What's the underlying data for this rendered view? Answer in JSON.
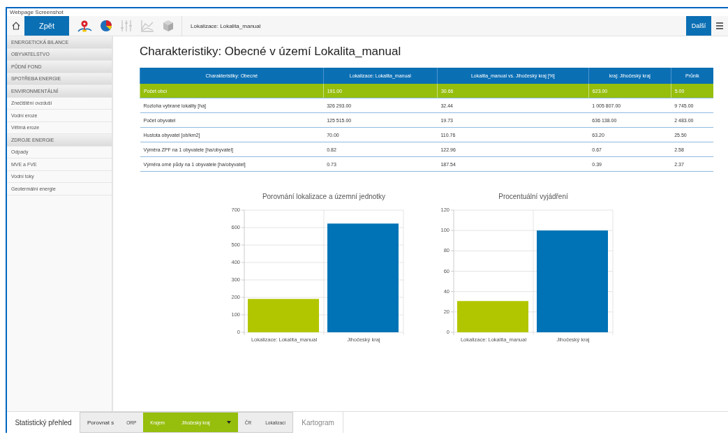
{
  "caption": "Webpage Screenshot",
  "toolbar": {
    "back_button": "Zpět",
    "tools": [
      {
        "kind": "pin",
        "disabled": false
      },
      {
        "kind": "pie",
        "disabled": false
      },
      {
        "kind": "sliders",
        "disabled": true
      },
      {
        "kind": "linechart",
        "disabled": true
      },
      {
        "kind": "cube",
        "disabled": true
      }
    ],
    "location": "Lokalizace: Lokalita_manual",
    "next_button": "Další"
  },
  "sidebar": {
    "items": [
      {
        "label": "ENERGETICKÁ BILANCE"
      },
      {
        "label": "OBYVATELSTVO"
      },
      {
        "label": "PŮDNÍ FOND"
      },
      {
        "label": "SPOTŘEBA ENERGIE"
      },
      {
        "label": "ENVIRONMENTÁLNÍ",
        "children": [
          {
            "label": "Znečištění ovzduší"
          },
          {
            "label": "Vodní eroze"
          },
          {
            "label": "Větrná eroze"
          }
        ]
      },
      {
        "label": "ZDROJE ENERGIE",
        "children": [
          {
            "label": "Odpady"
          },
          {
            "label": "MVE a FVE"
          },
          {
            "label": "Vodní toky"
          },
          {
            "label": "Geotermální energie"
          }
        ]
      }
    ]
  },
  "heading": "Charakteristiky: Obecné v území Lokalita_manual",
  "table": {
    "columns": [
      "Charakteristiky: Obecné",
      "Lokalizace: Lokalita_manual",
      "Lokalita_manual vs. Jihočeský kraj [%]",
      "kraj: Jihočeský kraj",
      "Průnik"
    ],
    "rows": [
      {
        "selected": true,
        "cells": [
          "Počet obcí",
          "191.00",
          "30.66",
          "623.00",
          "5.00"
        ]
      },
      {
        "selected": false,
        "cells": [
          "Rozloha vybrané lokality [ha]",
          "326 293.00",
          "32.44",
          "1 005 807.00",
          "9 745.00"
        ]
      },
      {
        "selected": false,
        "cells": [
          "Počet obyvatel",
          "125 515.00",
          "19.73",
          "636 138.00",
          "2 483.00"
        ]
      },
      {
        "selected": false,
        "cells": [
          "Hustota obyvatel [ob/km2]",
          "70.00",
          "110.76",
          "63.20",
          "25.50"
        ]
      },
      {
        "selected": false,
        "cells": [
          "Výměra ZPF na 1 obyvatele [ha/obyvatel]",
          "0.82",
          "122.96",
          "0.67",
          "2.58"
        ]
      },
      {
        "selected": false,
        "cells": [
          "Výměra orné půdy na 1 obyvatele [ha/obyvatel]",
          "0.73",
          "187.54",
          "0.39",
          "2.37"
        ]
      }
    ]
  },
  "charts": [
    {
      "chart_data": {
        "type": "bar",
        "title": "Porovnání lokalizace a územní jednotky",
        "grid": true,
        "series": [
          {
            "name": "Lokalizace: Lokalita_manual",
            "color": "#b2c600",
            "values": [
              191
            ]
          },
          {
            "name": "Jihočeský kraj",
            "color": "#0073b6",
            "values": [
              623
            ]
          }
        ],
        "ylim": [
          0,
          700
        ],
        "yticks": [
          0,
          100,
          200,
          300,
          400,
          500,
          600,
          700
        ]
      }
    },
    {
      "chart_data": {
        "type": "bar",
        "title": "Procentuální vyjádření",
        "grid": true,
        "series": [
          {
            "name": "Lokalizace: Lokalita_manual",
            "color": "#b2c600",
            "values": [
              30.7
            ]
          },
          {
            "name": "Jihočeský kraj",
            "color": "#0073b6",
            "values": [
              100
            ]
          }
        ],
        "ylim": [
          0,
          120
        ],
        "yticks": [
          0,
          20,
          40,
          60,
          80,
          100,
          120
        ]
      }
    }
  ],
  "bottom_bar": {
    "title": "Statistický přehled",
    "compare_label": "Porovnat s",
    "options": [
      {
        "label": "ORP",
        "selected": false
      },
      {
        "label": "Krajem",
        "selected": true,
        "value": "Jihočeský kraj"
      },
      {
        "label": "ČR",
        "selected": false
      },
      {
        "label": "Lokalizací",
        "selected": false
      }
    ],
    "map_tab": "Kartogram"
  }
}
